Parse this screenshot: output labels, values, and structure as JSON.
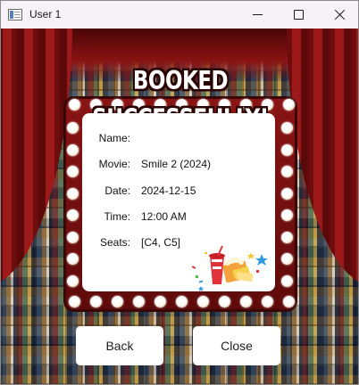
{
  "window": {
    "title": "User 1",
    "controls": {
      "minimize": "minimize-icon",
      "maximize": "maximize-icon",
      "close": "close-icon"
    }
  },
  "banner": {
    "text": "BOOKED SUCCESSFULLY!"
  },
  "details": [
    {
      "label": "Name:",
      "value": ""
    },
    {
      "label": "Movie:",
      "value": "Smile 2 (2024)"
    },
    {
      "label": "Date:",
      "value": "2024-12-15"
    },
    {
      "label": "Time:",
      "value": "12:00 AM"
    },
    {
      "label": "Seats:",
      "value": "[C4, C5]"
    }
  ],
  "actions": {
    "back": "Back",
    "close": "Close"
  },
  "colors": {
    "curtain": "#9e1a1a",
    "marquee": "#7a1010",
    "panel": "#ffffff",
    "titlebar": "#f7f2f7"
  }
}
